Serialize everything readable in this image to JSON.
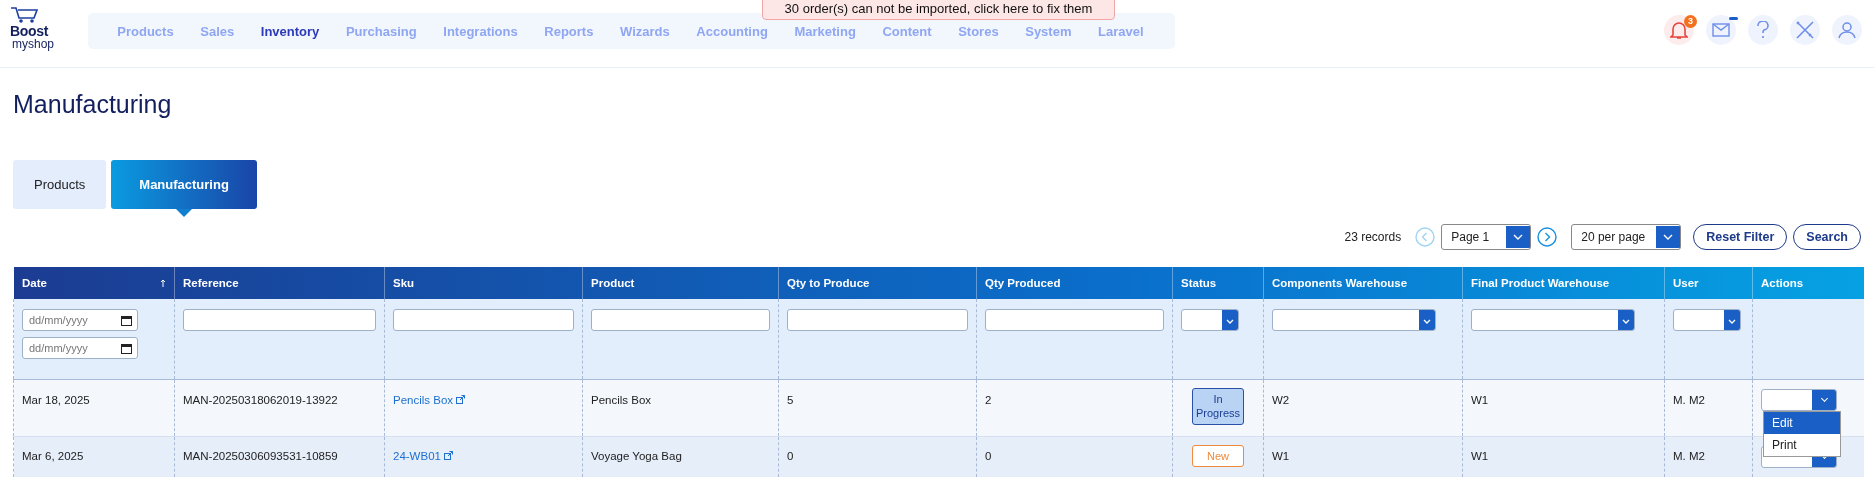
{
  "header": {
    "logo": {
      "line_1": "Boost",
      "line_2": "myshop"
    },
    "nav": [
      {
        "label": "Products",
        "selected": false
      },
      {
        "label": "Sales",
        "selected": false
      },
      {
        "label": "Inventory",
        "selected": true
      },
      {
        "label": "Purchasing",
        "selected": false
      },
      {
        "label": "Integrations",
        "selected": false
      },
      {
        "label": "Reports",
        "selected": false
      },
      {
        "label": "Wizards",
        "selected": false
      },
      {
        "label": "Accounting",
        "selected": false
      },
      {
        "label": "Marketing",
        "selected": false
      },
      {
        "label": "Content",
        "selected": false
      },
      {
        "label": "Stores",
        "selected": false
      },
      {
        "label": "System",
        "selected": false
      },
      {
        "label": "Laravel",
        "selected": false
      }
    ],
    "alert": "30 order(s) can not be imported, click here to fix them",
    "icons": [
      {
        "kind": "bell",
        "badge": "3"
      },
      {
        "kind": "mail",
        "unread": true
      },
      {
        "kind": "help"
      },
      {
        "kind": "tools"
      },
      {
        "kind": "user"
      }
    ]
  },
  "page": {
    "title": "Manufacturing"
  },
  "tabs": [
    {
      "label": "Products",
      "selected": false
    },
    {
      "label": "Manufacturing",
      "selected": true
    }
  ],
  "pager": {
    "records": "23 records",
    "prev_disabled": true,
    "page": "Page 1",
    "per_page": "20 per page",
    "buttons": [
      "Reset Filter",
      "Search"
    ]
  },
  "table": {
    "columns": [
      {
        "label": "Date",
        "sorted": true,
        "filter": {
          "kind": "date",
          "placeholders": [
            "dd/mm/yyyy",
            "dd/mm/yyyy"
          ]
        }
      },
      {
        "label": "Reference",
        "filter": {
          "kind": "text"
        }
      },
      {
        "label": "Sku",
        "filter": {
          "kind": "text"
        }
      },
      {
        "label": "Product",
        "filter": {
          "kind": "text"
        }
      },
      {
        "label": "Qty to Produce",
        "filter": {
          "kind": "text"
        }
      },
      {
        "label": "Qty Produced",
        "filter": {
          "kind": "text"
        }
      },
      {
        "label": "Status",
        "filter": {
          "kind": "select"
        }
      },
      {
        "label": "Components Warehouse",
        "filter": {
          "kind": "select"
        }
      },
      {
        "label": "Final Product Warehouse",
        "filter": {
          "kind": "select"
        }
      },
      {
        "label": "User",
        "filter": {
          "kind": "select"
        }
      },
      {
        "label": "Actions"
      }
    ],
    "rows": [
      {
        "date": "Mar 18, 2025",
        "reference": "MAN-20250318062019-13922",
        "sku": "Pencils Box",
        "product": "Pencils Box",
        "qty_to_produce": "5",
        "qty_produced": "2",
        "status": {
          "label": "In Progress",
          "kind": "in_progress"
        },
        "components_warehouse": "W2",
        "final_product_warehouse": "W1",
        "user": "M. M2",
        "actions": {
          "expanded": true,
          "menu": [
            {
              "label": "Edit",
              "selected": true
            },
            {
              "label": "Print",
              "selected": false
            }
          ]
        }
      },
      {
        "date": "Mar 6, 2025",
        "reference": "MAN-20250306093531-10859",
        "sku": "24-WB01",
        "product": "Voyage Yoga Bag",
        "qty_to_produce": "0",
        "qty_produced": "0",
        "status": {
          "label": "New",
          "kind": "new"
        },
        "components_warehouse": "W1",
        "final_product_warehouse": "W1",
        "user": "M. M2",
        "actions": {
          "expanded": false
        }
      }
    ]
  }
}
